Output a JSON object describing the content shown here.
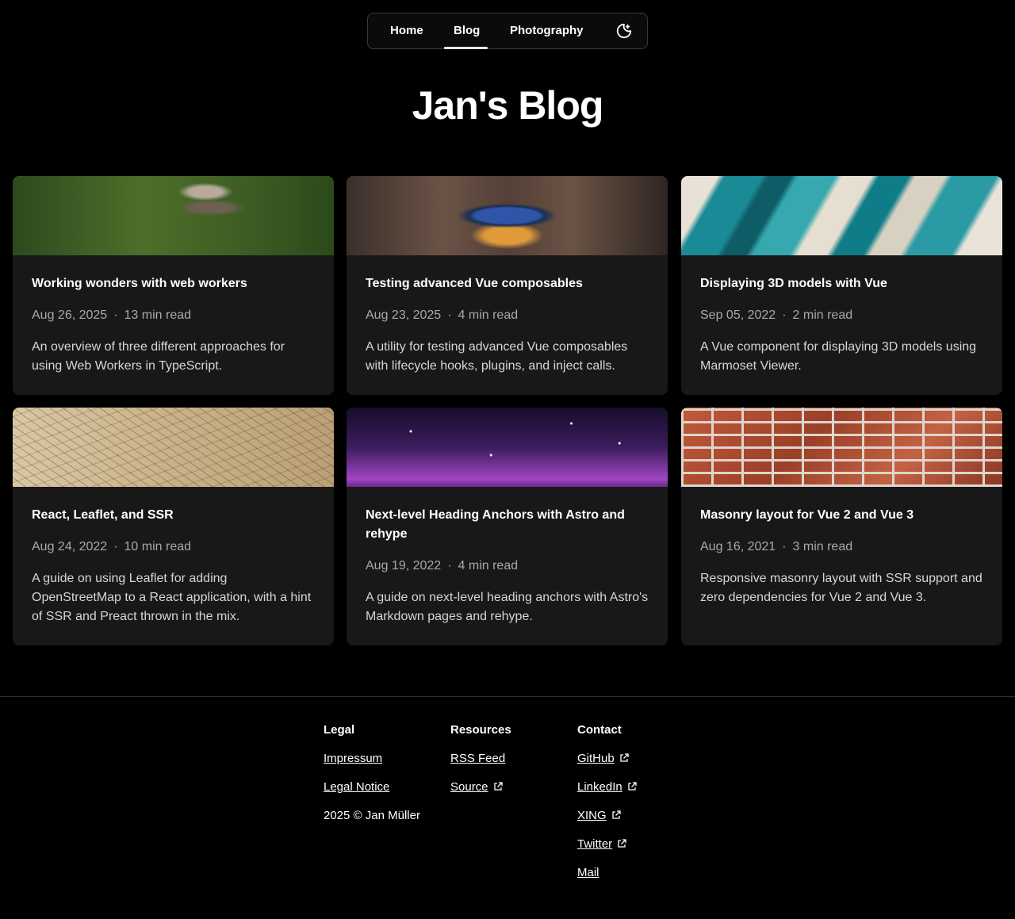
{
  "nav": {
    "items": [
      {
        "label": "Home"
      },
      {
        "label": "Blog"
      },
      {
        "label": "Photography"
      }
    ],
    "active": "Blog",
    "theme_icon": "moon-sun-icon"
  },
  "page_title": "Jan's Blog",
  "posts": [
    {
      "title": "Working wonders with web workers",
      "date": "Aug 26, 2025",
      "read_time": "13 min read",
      "description": "An overview of three different approaches for using Web Workers in TypeScript.",
      "image": "spider-photo"
    },
    {
      "title": "Testing advanced Vue composables",
      "date": "Aug 23, 2025",
      "read_time": "4 min read",
      "description": "A utility for testing advanced Vue composables with lifecycle hooks, plugins, and inject calls.",
      "image": "clockwork-photo"
    },
    {
      "title": "Displaying 3D models with Vue",
      "date": "Sep 05, 2022",
      "read_time": "2 min read",
      "description": "A Vue component for displaying 3D models using Marmoset Viewer.",
      "image": "marble-photo"
    },
    {
      "title": "React, Leaflet, and SSR",
      "date": "Aug 24, 2022",
      "read_time": "10 min read",
      "description": "A guide on using Leaflet for adding OpenStreetMap to a React application, with a hint of SSR and Preact thrown in the mix.",
      "image": "map-photo"
    },
    {
      "title": "Next-level Heading Anchors with Astro and rehype",
      "date": "Aug 19, 2022",
      "read_time": "4 min read",
      "description": "A guide on next-level heading anchors with Astro's Markdown pages and rehype.",
      "image": "night-sky-photo"
    },
    {
      "title": "Masonry layout for Vue 2 and Vue 3",
      "date": "Aug 16, 2021",
      "read_time": "3 min read",
      "description": "Responsive masonry layout with SSR support and zero dependencies for Vue 2 and Vue 3.",
      "image": "brick-wall-photo"
    }
  ],
  "separator": "·",
  "footer": {
    "legal": {
      "heading": "Legal",
      "links": [
        "Impressum",
        "Legal Notice"
      ],
      "copyright": "2025 © Jan Müller"
    },
    "resources": {
      "heading": "Resources",
      "links": [
        "RSS Feed",
        "Source"
      ]
    },
    "contact": {
      "heading": "Contact",
      "links": [
        "GitHub",
        "LinkedIn",
        "XING",
        "Twitter",
        "Mail"
      ]
    }
  },
  "colors": {
    "background": "#000000",
    "card": "#181818",
    "meta": "#a9a9a9"
  }
}
